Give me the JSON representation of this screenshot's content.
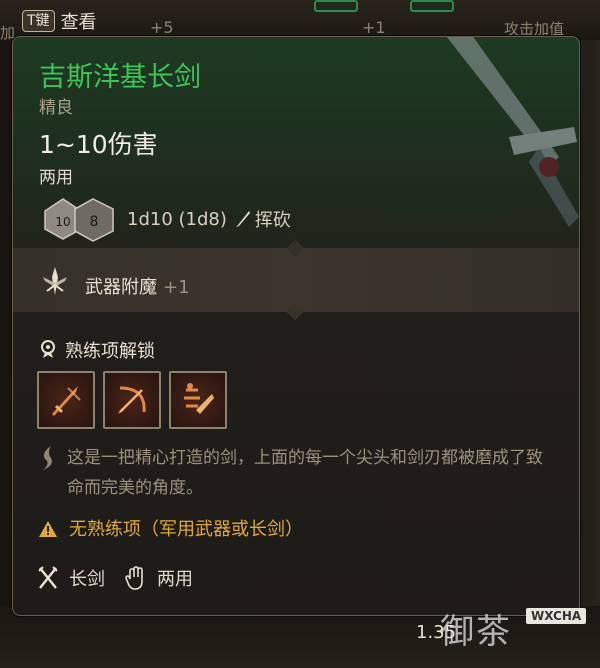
{
  "background": {
    "key_hint": {
      "key": "T键",
      "text": "查看"
    },
    "numbers": [
      "+5",
      "+1"
    ],
    "side_left": "加",
    "side_right": "攻击加值",
    "weight": "1.35"
  },
  "watermark": {
    "text": "御茶",
    "badge": "WXCHA"
  },
  "item": {
    "name": "吉斯洋基长剑",
    "rarity": "精良",
    "damage": "1~10伤害",
    "handedness": "两用",
    "dice": [
      "10",
      "8"
    ],
    "dice_text": "1d10 (1d8)",
    "damage_type": "挥砍"
  },
  "enchant": {
    "label": "武器附魔",
    "value": "+1"
  },
  "proficiency": {
    "title": "熟练项解锁",
    "actions": [
      {
        "icon": "sword-strike-icon"
      },
      {
        "icon": "bow-slash-icon"
      },
      {
        "icon": "rush-attack-icon"
      }
    ]
  },
  "description": "这是一把精心打造的剑，上面的每一个尖头和剑刃都被磨成了致命而完美的角度。",
  "warning": "无熟练项（军用武器或长剑）",
  "properties": [
    {
      "icon": "crossed-swords-icon",
      "label": "长剑"
    },
    {
      "icon": "hand-icon",
      "label": "两用"
    }
  ],
  "colors": {
    "name": "#3fc35a",
    "warning": "#e0a93a",
    "muted": "#9b917f"
  }
}
